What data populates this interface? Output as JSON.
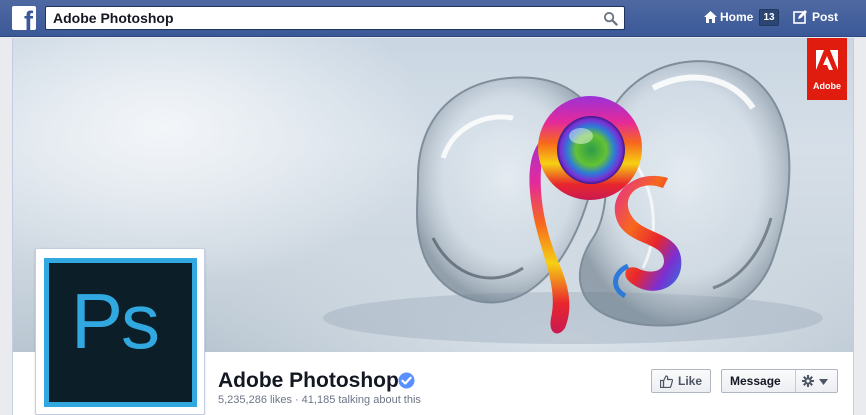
{
  "topbar": {
    "search": {
      "value": "Adobe Photoshop",
      "placeholder": ""
    },
    "home": {
      "label": "Home",
      "count": "13"
    },
    "post": {
      "label": "Post"
    },
    "icons": {
      "logo": "facebook-logo",
      "search": "search-icon",
      "home": "home-icon",
      "post": "post-icon"
    },
    "colors": {
      "bar": "#3b5998"
    }
  },
  "cover": {
    "badge_label": "Adobe",
    "badge_color": "#e01c0f"
  },
  "profile": {
    "logo_text": "Ps",
    "logo_colors": {
      "background": "#0c1e28",
      "accent": "#31a8e0"
    }
  },
  "page": {
    "name": "Adobe Photoshop",
    "verified": true,
    "likes": "5,235,286 likes",
    "separator": "·",
    "talking": "41,185 talking about this"
  },
  "actions": {
    "like_label": "Like",
    "message_label": "Message"
  }
}
